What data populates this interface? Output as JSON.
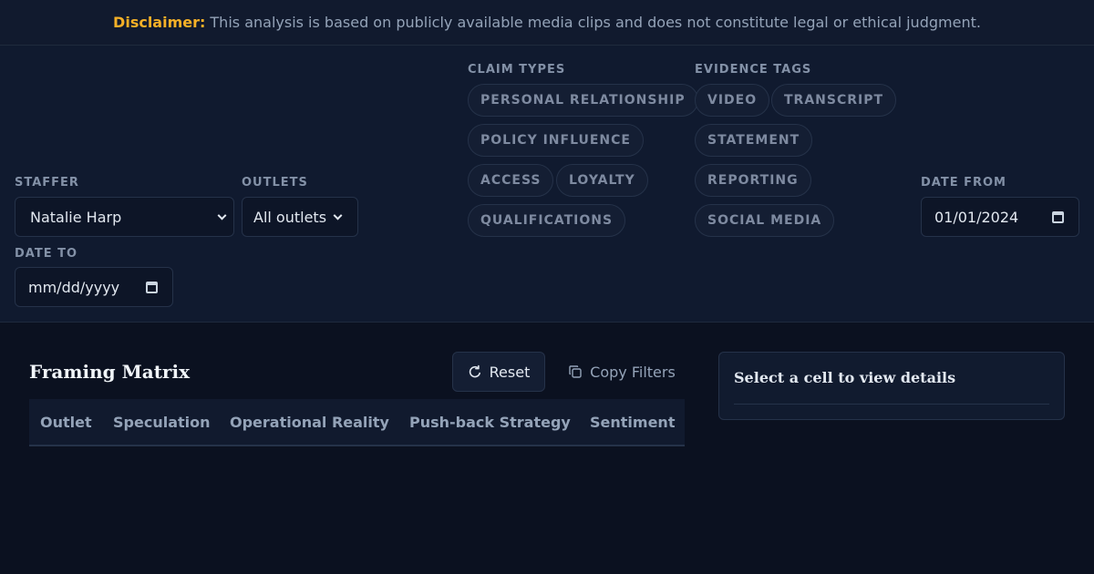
{
  "disclaimer": {
    "label": "Disclaimer:",
    "text": "This analysis is based on publicly available media clips and does not constitute legal or ethical judgment."
  },
  "filters": {
    "staffer": {
      "label": "STAFFER",
      "value": "Natalie Harp"
    },
    "outlets": {
      "label": "OUTLETS",
      "value": "All outlets"
    },
    "claim_types": {
      "label": "CLAIM TYPES",
      "items": [
        "PERSONAL RELATIONSHIP",
        "POLICY INFLUENCE",
        "ACCESS",
        "LOYALTY",
        "QUALIFICATIONS"
      ]
    },
    "evidence_tags": {
      "label": "EVIDENCE TAGS",
      "items": [
        "VIDEO",
        "TRANSCRIPT",
        "STATEMENT",
        "REPORTING",
        "SOCIAL MEDIA"
      ]
    },
    "date_from": {
      "label": "DATE FROM",
      "value": "01/01/2024"
    },
    "date_to": {
      "label": "DATE TO",
      "placeholder": "mm/dd/yyyy"
    }
  },
  "matrix": {
    "title": "Framing Matrix",
    "reset_label": "Reset",
    "copy_label": "Copy Filters",
    "columns": [
      "Outlet",
      "Speculation",
      "Operational Reality",
      "Push-back Strategy",
      "Sentiment"
    ]
  },
  "details": {
    "title": "Select a cell to view details"
  },
  "colors": {
    "accent": "#f5b027",
    "background": "#0b1120",
    "panel": "#101a2f",
    "border": "#253249"
  },
  "icons": {
    "reset": "refresh-icon",
    "copy": "copy-icon",
    "select": "chevron-down-icon",
    "date": "calendar-icon"
  }
}
